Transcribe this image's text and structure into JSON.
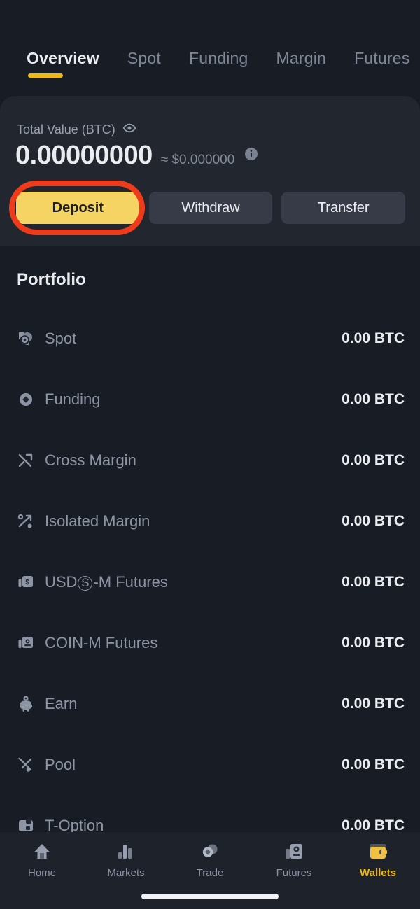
{
  "tabs": [
    {
      "label": "Overview",
      "active": true
    },
    {
      "label": "Spot",
      "active": false
    },
    {
      "label": "Funding",
      "active": false
    },
    {
      "label": "Margin",
      "active": false
    },
    {
      "label": "Futures",
      "active": false
    }
  ],
  "balance_card": {
    "label": "Total Value (BTC)",
    "eye_icon": "eye-icon",
    "amount": "0.00000000",
    "approx": "≈ $0.000000",
    "info_icon": "info-icon"
  },
  "actions": {
    "deposit": "Deposit",
    "withdraw": "Withdraw",
    "transfer": "Transfer",
    "highlight_color": "#ee3b1c",
    "primary_color": "#f5d463"
  },
  "portfolio": {
    "title": "Portfolio",
    "rows": [
      {
        "label": "Spot",
        "value": "0.00 BTC",
        "icon": "spot-icon"
      },
      {
        "label": "Funding",
        "value": "0.00 BTC",
        "icon": "funding-icon"
      },
      {
        "label": "Cross Margin",
        "value": "0.00 BTC",
        "icon": "cross-margin-icon"
      },
      {
        "label": "Isolated Margin",
        "value": "0.00 BTC",
        "icon": "isolated-margin-icon"
      },
      {
        "label": "USDⓈ-M Futures",
        "value": "0.00 BTC",
        "icon": "usd-m-futures-icon"
      },
      {
        "label": "COIN-M Futures",
        "value": "0.00 BTC",
        "icon": "coin-m-futures-icon"
      },
      {
        "label": "Earn",
        "value": "0.00 BTC",
        "icon": "earn-icon"
      },
      {
        "label": "Pool",
        "value": "0.00 BTC",
        "icon": "pool-icon"
      },
      {
        "label": "T-Option",
        "value": "0.00 BTC",
        "icon": "t-option-icon"
      }
    ]
  },
  "bottom_nav": {
    "items": [
      {
        "label": "Home",
        "icon": "home-icon",
        "active": false
      },
      {
        "label": "Markets",
        "icon": "markets-icon",
        "active": false
      },
      {
        "label": "Trade",
        "icon": "trade-icon",
        "active": false
      },
      {
        "label": "Futures",
        "icon": "futures-icon",
        "active": false
      },
      {
        "label": "Wallets",
        "icon": "wallets-icon",
        "active": true
      }
    ],
    "active_color": "#f0b90b"
  }
}
